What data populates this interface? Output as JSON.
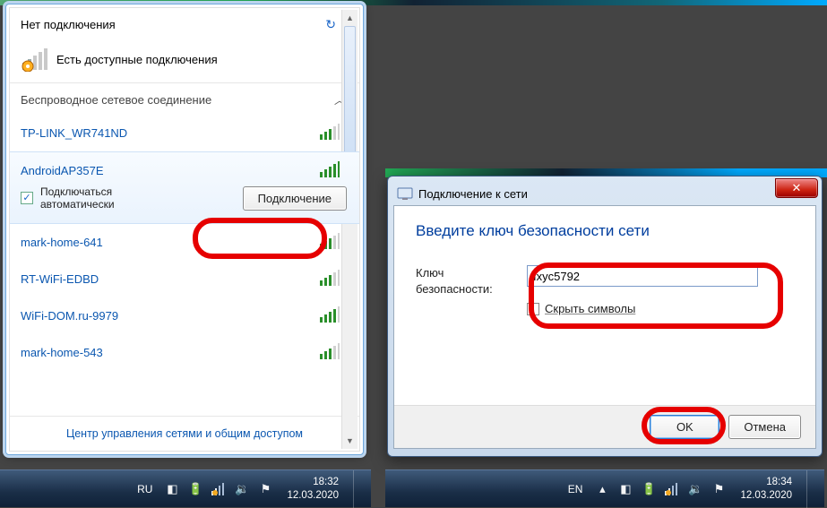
{
  "wifi_popup": {
    "no_connection": "Нет подключения",
    "available_note": "Есть доступные подключения",
    "section_title": "Беспроводное сетевое соединение",
    "auto_connect_label": "Подключаться автоматически",
    "connect_button": "Подключение",
    "footer_link": "Центр управления сетями и общим доступом",
    "networks": [
      {
        "ssid": "TP-LINK_WR741ND",
        "strength": 3,
        "selected": false
      },
      {
        "ssid": "AndroidAP357E",
        "strength": 5,
        "selected": true
      },
      {
        "ssid": "mark-home-641",
        "strength": 3,
        "selected": false
      },
      {
        "ssid": "RT-WiFi-EDBD",
        "strength": 3,
        "selected": false
      },
      {
        "ssid": "WiFi-DOM.ru-9979",
        "strength": 4,
        "selected": false
      },
      {
        "ssid": "mark-home-543",
        "strength": 3,
        "selected": false
      }
    ]
  },
  "dialog": {
    "title": "Подключение к сети",
    "heading": "Введите ключ безопасности сети",
    "key_label": "Ключ безопасности:",
    "key_value": "Ixyc5792",
    "hide_label": "Скрыть символы",
    "ok": "OK",
    "cancel": "Отмена"
  },
  "taskbar_left": {
    "lang": "RU",
    "time": "18:32",
    "date": "12.03.2020"
  },
  "taskbar_right": {
    "lang": "EN",
    "time": "18:34",
    "date": "12.03.2020"
  }
}
